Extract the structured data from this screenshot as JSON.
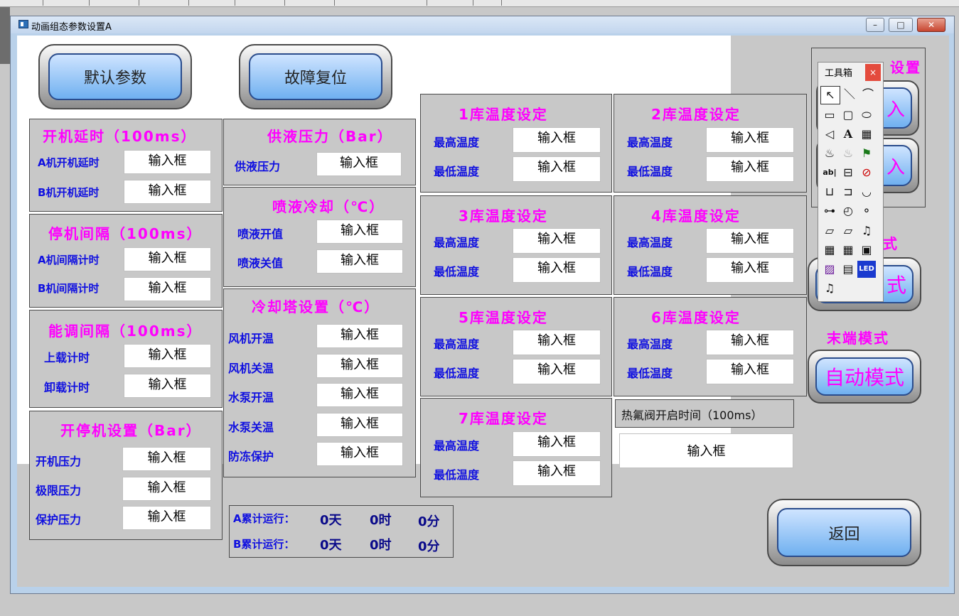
{
  "window": {
    "title": "动画组态参数设置A",
    "minimize": "–",
    "maximize": "□",
    "close": "✕"
  },
  "buttons": {
    "default_params": "默认参数",
    "fault_reset": "故障复位",
    "return": "返回"
  },
  "input_placeholder": "输入框",
  "startup_delay": {
    "title": "开机延时（100ms）",
    "row1": "A机开机延时",
    "row2": "B机开机延时"
  },
  "stop_interval": {
    "title": "停机间隔（100ms）",
    "row1": "A机间隔计时",
    "row2": "B机间隔计时"
  },
  "capacity_interval": {
    "title": "能调间隔（100ms）",
    "row1": "上载计时",
    "row2": "卸载计时"
  },
  "start_stop": {
    "title": "开停机设置（Bar）",
    "row1": "开机压力",
    "row2": "极限压力",
    "row3": "保护压力"
  },
  "supply_pressure": {
    "title": "供液压力（Bar）",
    "row1": "供液压力"
  },
  "spray_cooling": {
    "title": "喷液冷却（℃）",
    "row1": "喷液开值",
    "row2": "喷液关值"
  },
  "cooling_tower": {
    "title": "冷却塔设置（℃）",
    "row1": "风机开温",
    "row2": "风机关温",
    "row3": "水泵开温",
    "row4": "水泵关温",
    "row5": "防冻保护"
  },
  "rooms": [
    {
      "title": "1库温度设定",
      "max": "最高温度",
      "min": "最低温度"
    },
    {
      "title": "2库温度设定",
      "max": "最高温度",
      "min": "最低温度"
    },
    {
      "title": "3库温度设定",
      "max": "最高温度",
      "min": "最低温度"
    },
    {
      "title": "4库温度设定",
      "max": "最高温度",
      "min": "最低温度"
    },
    {
      "title": "5库温度设定",
      "max": "最高温度",
      "min": "最低温度"
    },
    {
      "title": "6库温度设定",
      "max": "最高温度",
      "min": "最低温度"
    },
    {
      "title": "7库温度设定",
      "max": "最高温度",
      "min": "最低温度"
    }
  ],
  "hot_gas_valve": {
    "label": "热氟阀开启时间（100ms）"
  },
  "runtime": {
    "a_label": "A累计运行：",
    "a_days": "0天",
    "a_hours": "0时",
    "a_mins": "0分",
    "b_label": "B累计运行：",
    "b_days": "0天",
    "b_hours": "0时",
    "b_mins": "0分"
  },
  "right_panel": {
    "title_partial": "设置",
    "btn1_partial": "入",
    "btn2_partial": "入",
    "mode_label_partial": "式",
    "mode_btn_partial": "式",
    "end_mode_label": "末端模式",
    "end_mode_btn": "自动模式"
  },
  "toolbox": {
    "title": "工具箱",
    "close": "×",
    "tools": [
      "↖",
      "＼",
      "⌒",
      "▭",
      "▢",
      "⬭",
      "◁",
      "A",
      "▦",
      "♨",
      "♨",
      "⚑",
      "ab|",
      "⊟",
      "⊘",
      "⊔",
      "⊐",
      "◡",
      "⊶",
      "◴",
      "⚬",
      "▱",
      "▱",
      "♫",
      "▦",
      "▦",
      "▣",
      "▨",
      "▤",
      "LED",
      "♫"
    ]
  }
}
